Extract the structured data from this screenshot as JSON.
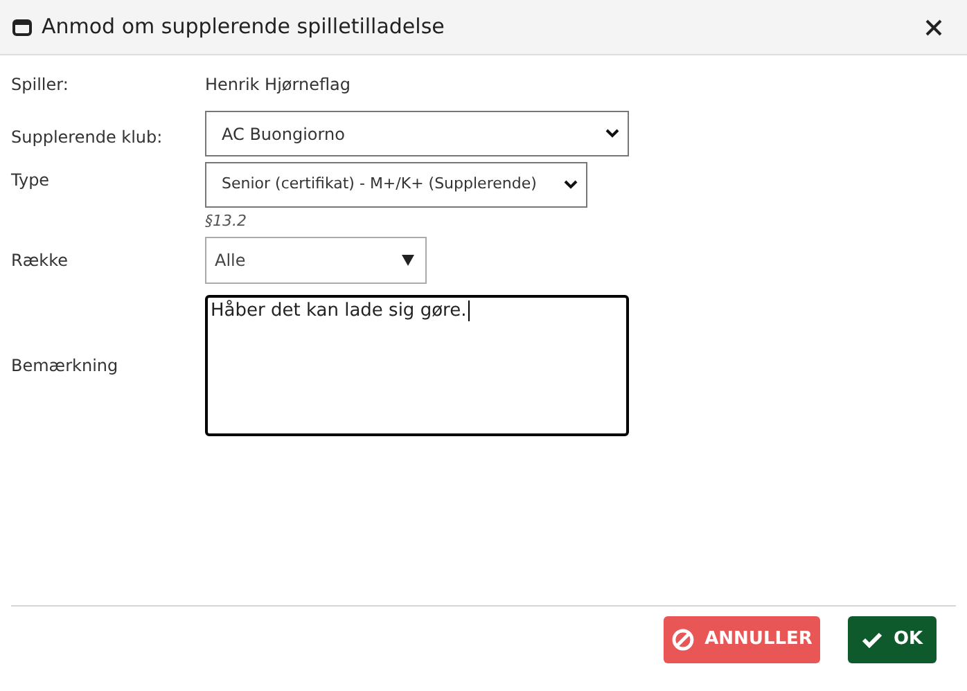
{
  "window": {
    "title": "Anmod om supplerende spilletilladelse"
  },
  "fields": [
    {
      "kind": "text",
      "label": "Spiller:",
      "value": "Henrik Hjørneflag"
    },
    {
      "kind": "select",
      "label": "Supplerende klub:",
      "value": "AC Buongiorno"
    },
    {
      "kind": "select",
      "label": "Type",
      "value": "Senior (certifikat) - M+/K+ (Supplerende)",
      "note": "§13.2"
    },
    {
      "kind": "dropdown",
      "label": "Række",
      "value": "Alle"
    },
    {
      "kind": "textarea",
      "label": "Bemærkning",
      "value": "Håber det kan lade sig gøre.",
      "focused": true
    }
  ],
  "buttons": [
    {
      "kind": "cancel",
      "label": "ANNULLER"
    },
    {
      "kind": "ok",
      "label": "OK"
    }
  ]
}
